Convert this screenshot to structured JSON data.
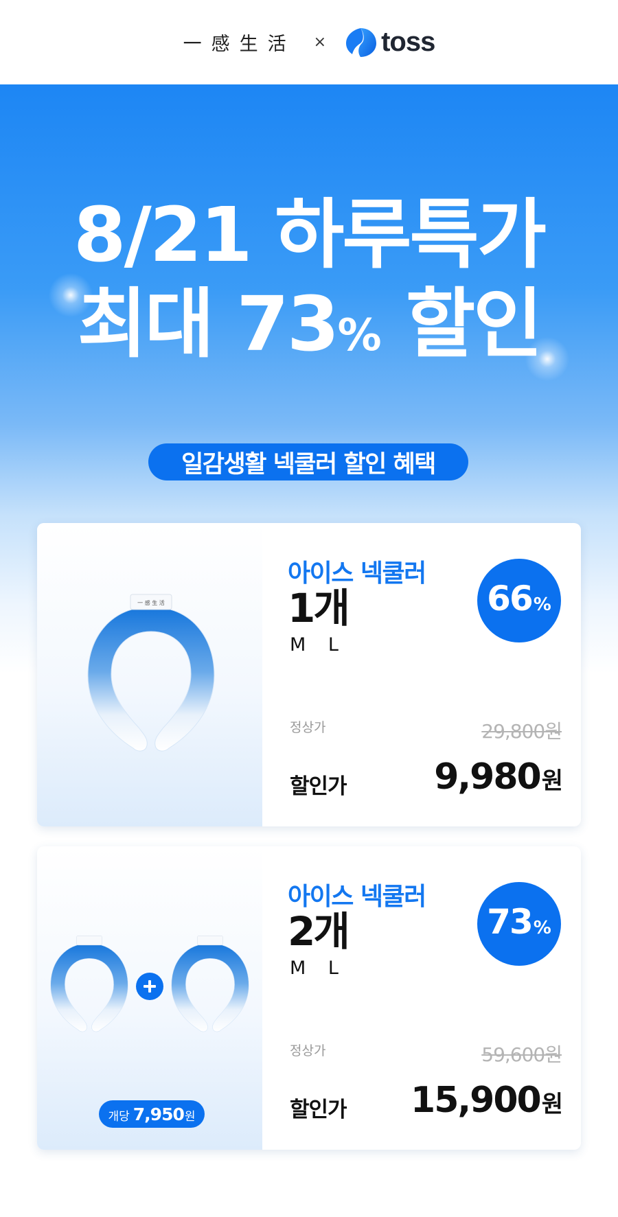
{
  "header": {
    "brand_korean": "一感生活",
    "collab_mark": "×",
    "partner_name": "toss"
  },
  "hero": {
    "headline_line1": "8/21 하루특가",
    "headline_line2_prefix": "최대 73",
    "headline_line2_percent": "%",
    "headline_line2_suffix": " 할인",
    "section_pill": "일감생활 넥쿨러 할인 혜택"
  },
  "colors": {
    "accent": "#0b71ef",
    "product_name": "#1377f0",
    "hero_top": "#1d86f4"
  },
  "products": [
    {
      "name": "아이스 넥쿨러",
      "quantity": "1개",
      "sizes": "M L",
      "discount": "66",
      "discount_unit": "%",
      "regular_label": "정상가",
      "regular_price": "29,800원",
      "sale_label": "할인가",
      "sale_price": "9,980",
      "sale_unit": "원",
      "image": "neck-cooler-single"
    },
    {
      "name": "아이스 넥쿨러",
      "quantity": "2개",
      "sizes": "M L",
      "discount": "73",
      "discount_unit": "%",
      "regular_label": "정상가",
      "regular_price": "59,600원",
      "sale_label": "할인가",
      "sale_price": "15,900",
      "sale_unit": "원",
      "image": "neck-cooler-pair",
      "per_unit_label": "개당",
      "per_unit_price": "7,950",
      "per_unit_suffix": "원"
    }
  ]
}
